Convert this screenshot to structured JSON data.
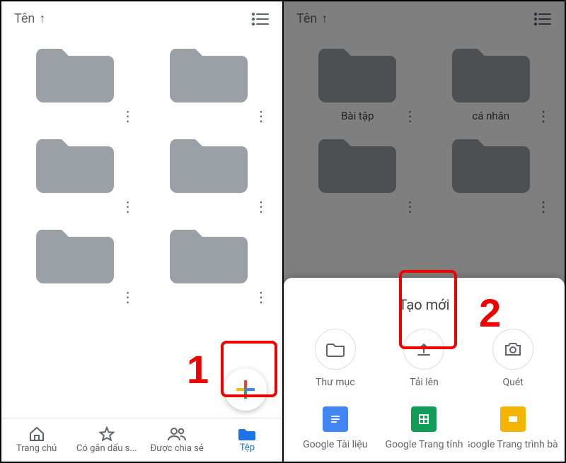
{
  "left": {
    "sort_label": "Tên",
    "folders": [
      {
        "name": ""
      },
      {
        "name": ""
      },
      {
        "name": ""
      },
      {
        "name": ""
      },
      {
        "name": ""
      },
      {
        "name": ""
      }
    ],
    "nav": {
      "home": "Trang chủ",
      "starred": "Có gắn dấu s...",
      "shared": "Được chia sẻ",
      "files": "Tệp"
    },
    "step_number": "1"
  },
  "right": {
    "sort_label": "Tên",
    "folders": [
      {
        "name": "Bài tập"
      },
      {
        "name": "cá nhân"
      },
      {
        "name": ""
      },
      {
        "name": ""
      }
    ],
    "sheet": {
      "title": "Tạo mới",
      "items": {
        "folder": "Thư mục",
        "upload": "Tải lên",
        "scan": "Quét",
        "docs": "Google Tài liệu",
        "sheets": "Google Trang tính",
        "slides": "Google Trang trình bày"
      }
    },
    "step_number": "2"
  },
  "colors": {
    "folder_gray": "#9aa0a6",
    "folder_dark": "#414549",
    "google_blue": "#4285f4",
    "google_red": "#ea4335",
    "google_yellow": "#fbbc04",
    "google_green": "#34a853",
    "docs_blue": "#4285f4",
    "sheets_green": "#0f9d58",
    "slides_yellow": "#f4b400"
  }
}
